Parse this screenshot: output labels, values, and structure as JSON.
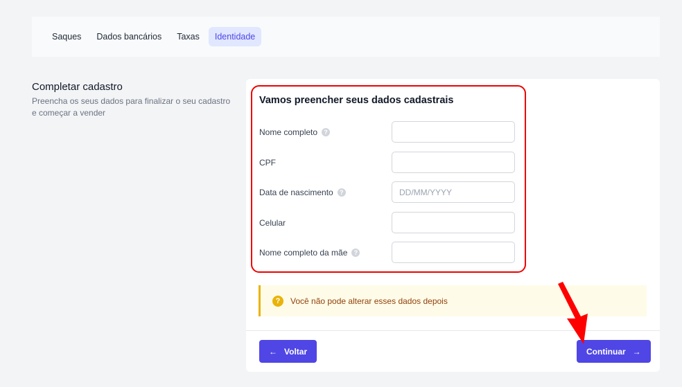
{
  "tabs": [
    "Saques",
    "Dados bancários",
    "Taxas",
    "Identidade"
  ],
  "active_tab": "Identidade",
  "section": {
    "title": "Completar cadastro",
    "description": "Preencha os seus dados para finalizar o seu cadastro e começar a vender"
  },
  "form": {
    "title": "Vamos preencher seus dados cadastrais",
    "fields": [
      {
        "label": "Nome completo",
        "value": "",
        "placeholder": ""
      },
      {
        "label": "CPF",
        "value": "",
        "placeholder": ""
      },
      {
        "label": "Data de nascimento",
        "value": "",
        "placeholder": "DD/MM/YYYY"
      },
      {
        "label": "Celular",
        "value": "",
        "placeholder": ""
      },
      {
        "label": "Nome completo da mãe",
        "value": "",
        "placeholder": ""
      }
    ]
  },
  "warning": "Você não pode alterar esses dados depois",
  "buttons": {
    "back": "Voltar",
    "next": "Continuar"
  },
  "colors": {
    "accent": "#4f46e5",
    "highlight": "#ee0000",
    "warning": "#eab308"
  }
}
